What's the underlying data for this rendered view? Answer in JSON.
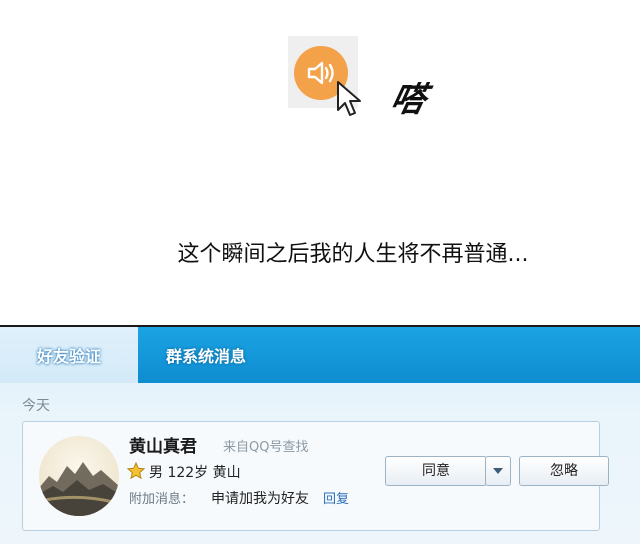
{
  "meme": {
    "sound_effect": "嗒",
    "caption": "这个瞬间之后我的人生将不再普通..."
  },
  "tabs": [
    {
      "label": "好友验证",
      "active": true
    },
    {
      "label": "群系统消息",
      "active": false
    }
  ],
  "section": {
    "date_label": "今天"
  },
  "request": {
    "name": "黄山真君",
    "source": "来自QQ号查找",
    "details": "男 122岁 黄山",
    "extra_label": "附加消息：",
    "extra_message": "申请加我为好友",
    "reply_link": "回复"
  },
  "buttons": {
    "agree": "同意",
    "ignore": "忽略"
  },
  "colors": {
    "tab_bar": "#1ba3e3",
    "speaker": "#f3a24a",
    "link": "#2a6fb8"
  },
  "icons": [
    "speaker-icon",
    "mouse-cursor-icon",
    "star-icon",
    "chevron-down-icon"
  ]
}
